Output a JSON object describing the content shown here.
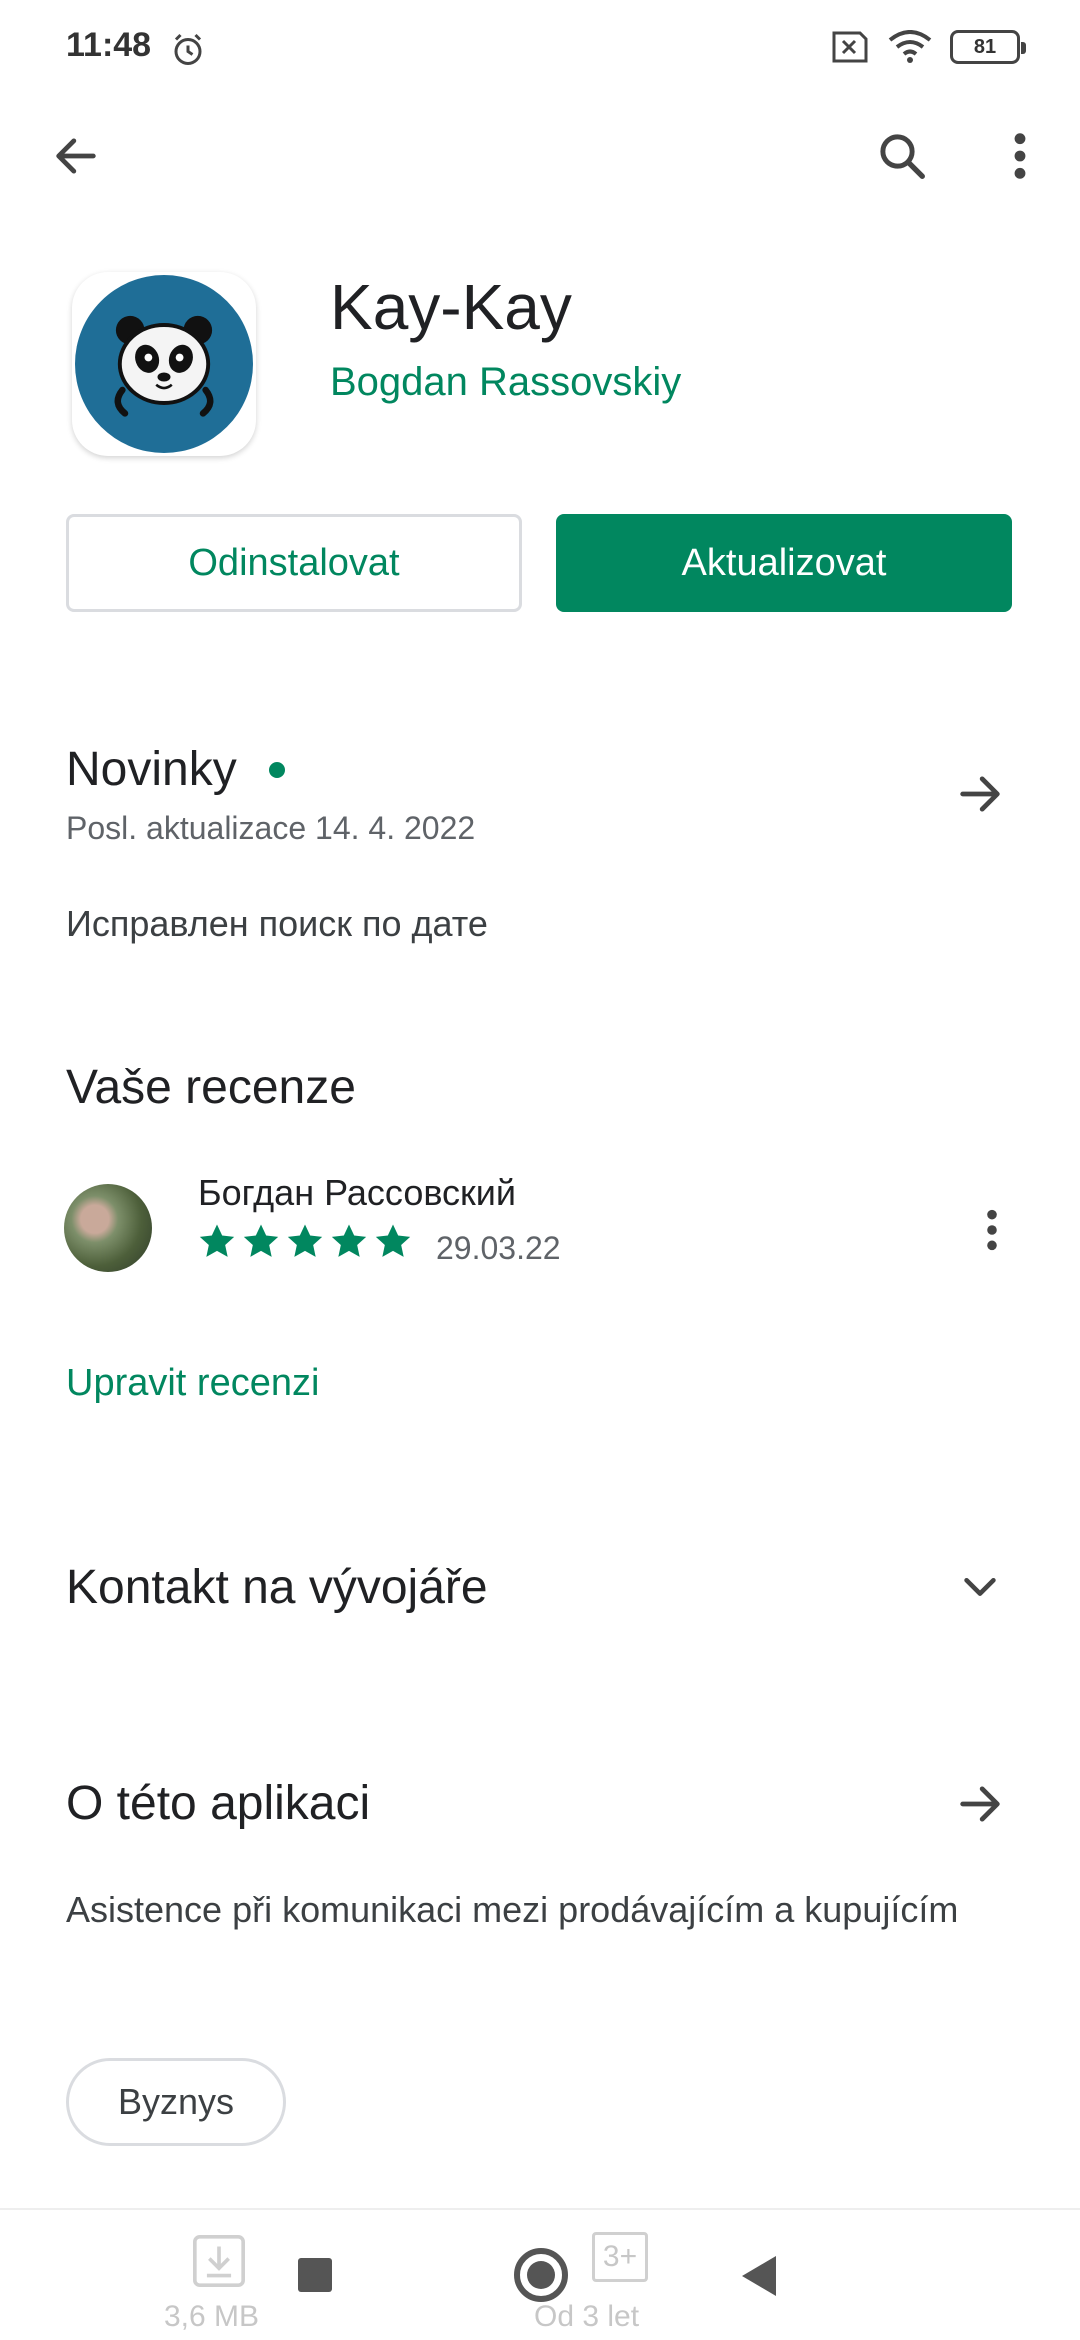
{
  "status_bar": {
    "time": "11:48",
    "battery": "81"
  },
  "app": {
    "title": "Kay-Kay",
    "developer": "Bogdan Rassovskiy",
    "uninstall_label": "Odinstalovat",
    "update_label": "Aktualizovat"
  },
  "whats_new": {
    "title": "Novinky",
    "updated": "Posl. aktualizace 14. 4. 2022",
    "notes": "Исправлен поиск по дате"
  },
  "your_review": {
    "title": "Vaše recenze",
    "reviewer": "Богдан Рассовский",
    "rating": 5,
    "date": "29.03.22",
    "edit_label": "Upravit recenzi"
  },
  "developer_contact": {
    "title": "Kontakt na vývojáře"
  },
  "about": {
    "title": "O této aplikaci",
    "description": "Asistence při komunikaci mezi prodávajícím a kupujícím",
    "category": "Byznys"
  },
  "bottom_stats": {
    "size": "3,6 MB",
    "age_badge": "3+",
    "age_label": "Od 3 let"
  },
  "colors": {
    "accent": "#01875f",
    "icon_bg": "#1f6e97"
  }
}
